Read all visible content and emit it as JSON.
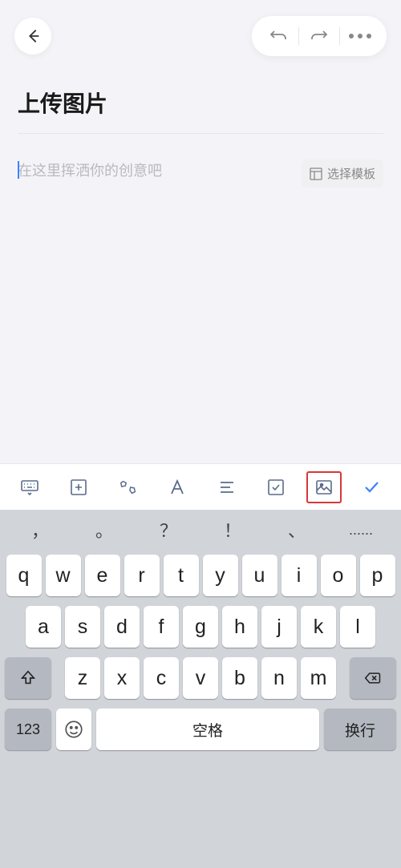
{
  "header": {
    "title": "上传图片"
  },
  "editor": {
    "placeholder": "在这里挥洒你的创意吧",
    "template_button": "选择模板"
  },
  "keyboard": {
    "punctuation": [
      "，",
      "。",
      "？",
      "！",
      "、",
      "......"
    ],
    "row1": [
      "q",
      "w",
      "e",
      "r",
      "t",
      "y",
      "u",
      "i",
      "o",
      "p"
    ],
    "row2": [
      "a",
      "s",
      "d",
      "f",
      "g",
      "h",
      "j",
      "k",
      "l"
    ],
    "row3": [
      "z",
      "x",
      "c",
      "v",
      "b",
      "n",
      "m"
    ],
    "num_label": "123",
    "space_label": "空格",
    "return_label": "换行"
  }
}
